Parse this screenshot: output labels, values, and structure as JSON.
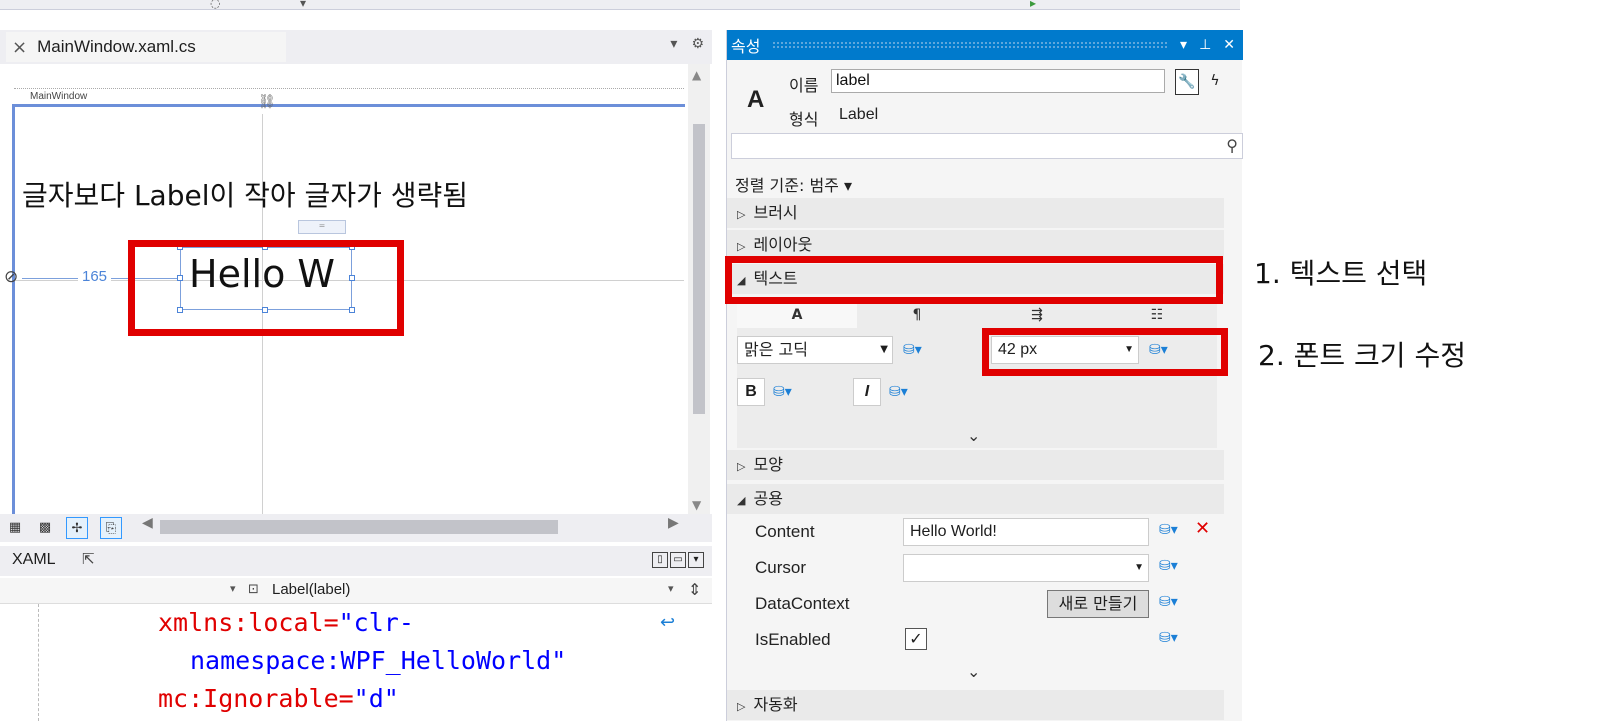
{
  "designer": {
    "tab_title": "MainWindow.xaml.cs",
    "window_caption": "MainWindow",
    "margin_value": "165",
    "label_text": "Hello W",
    "note": "글자보다 Label이 작아 글자가 생략됨"
  },
  "xaml": {
    "tab_label": "XAML",
    "element_selector": "Label(label)",
    "code_lines": [
      {
        "attr": "xmlns:local=",
        "val": "\"clr-"
      },
      {
        "attr": "",
        "val": "namespace:WPF_HelloWorld\""
      },
      {
        "attr": "mc:Ignorable=",
        "val": "\"d\""
      }
    ]
  },
  "properties": {
    "panel_title": "속성",
    "name_label": "이름",
    "name_value": "label",
    "type_label": "형식",
    "type_value": "Label",
    "sort_by": "정렬 기준: 범주",
    "categories": {
      "brush": "브러시",
      "layout": "레이아웃",
      "text": "텍스트",
      "appearance": "모양",
      "common": "공용",
      "next": "자동화"
    },
    "text_tabs": [
      "A",
      "¶",
      "⇶",
      "☷"
    ],
    "font_family": "맑은 고딕",
    "font_size": "42 px",
    "bold_label": "B",
    "italic_label": "I",
    "common_rows": [
      {
        "name": "Content",
        "value": "Hello World!"
      },
      {
        "name": "Cursor",
        "value": ""
      },
      {
        "name": "DataContext",
        "button": "새로 만들기"
      },
      {
        "name": "IsEnabled",
        "checked": "✓"
      }
    ]
  },
  "annotations": {
    "step1": "1. 텍스트 선택",
    "step2": "2. 폰트 크기 수정"
  },
  "colors": {
    "highlight": "#e00000",
    "accent": "#007acc"
  }
}
